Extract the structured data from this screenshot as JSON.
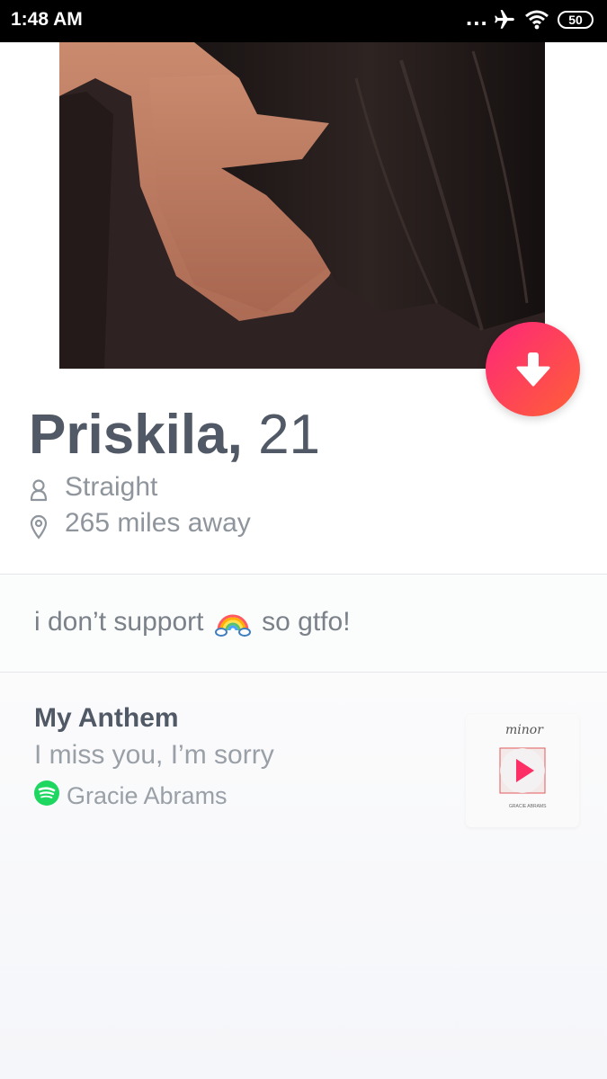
{
  "status_bar": {
    "time": "1:48 AM",
    "more": "...",
    "battery": "50"
  },
  "profile": {
    "first_name": "Priskila,",
    "age": "21",
    "orientation": "Straight",
    "distance": "265 miles away"
  },
  "bio": {
    "before": "i don’t support",
    "emoji": "rainbow-emoji",
    "after": "so gtfo!"
  },
  "anthem": {
    "title": "My Anthem",
    "song": "I miss you, I’m sorry",
    "artist": "Gracie Abrams",
    "album_title": "minor",
    "album_credit": "GRACIE ABRAMS"
  },
  "colors": {
    "accent_start": "#fd267a",
    "accent_end": "#ff6036",
    "name_text": "#505965",
    "secondary_text": "#8f959c",
    "spotify_green": "#1ed760"
  }
}
